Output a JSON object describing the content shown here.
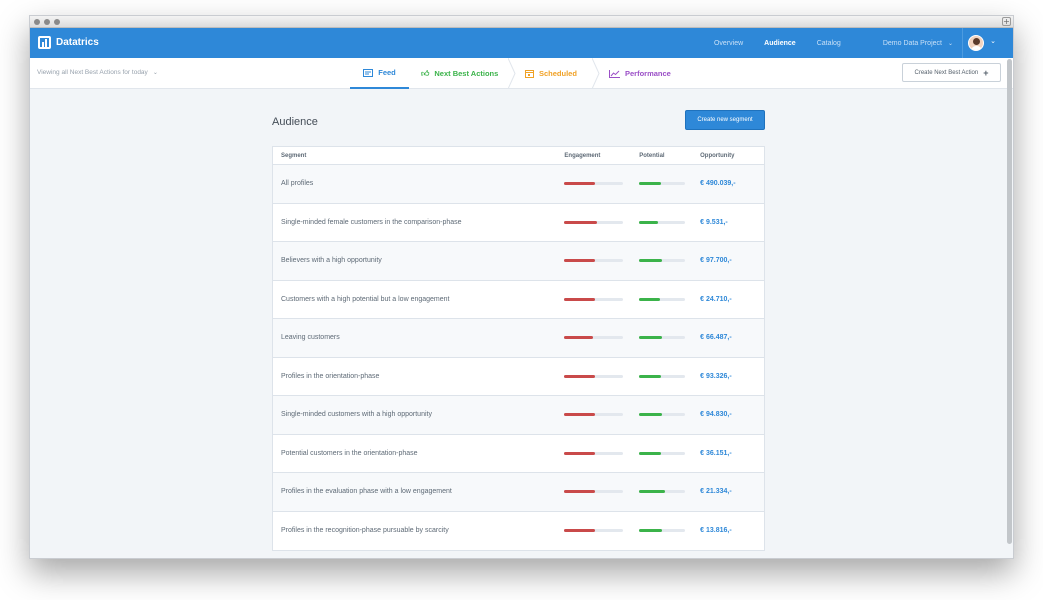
{
  "app": {
    "name": "Datatrics"
  },
  "topnav": {
    "items": [
      {
        "label": "Overview",
        "active": false
      },
      {
        "label": "Audience",
        "active": true
      },
      {
        "label": "Catalog",
        "active": false
      },
      {
        "label": "Demo Data Project",
        "active": false
      }
    ]
  },
  "subbar": {
    "filter_label": "Viewing all Next Best Actions for today",
    "tabs": [
      {
        "label": "Feed",
        "icon": "newspaper-icon",
        "color": "#2e88d8"
      },
      {
        "label": "Next Best Actions",
        "icon": "thumbs-up-icon",
        "color": "#3bb34a"
      },
      {
        "label": "Scheduled",
        "icon": "calendar-icon",
        "color": "#f0a125"
      },
      {
        "label": "Performance",
        "icon": "line-chart-icon",
        "color": "#9b4fc7"
      }
    ],
    "create_action_label": "Create Next Best Action",
    "create_action_plus": "+"
  },
  "audience": {
    "title": "Audience",
    "create_segment_label": "Create new segment",
    "columns": {
      "segment": "Segment",
      "engagement": "Engagement",
      "potential": "Potential",
      "opportunity": "Opportunity"
    },
    "rows": [
      {
        "segment": "All profiles",
        "engagement": 0.52,
        "potential": 0.48,
        "opportunity": "€ 490.039,-"
      },
      {
        "segment": "Single-minded female customers in the comparison-phase",
        "engagement": 0.55,
        "potential": 0.4,
        "opportunity": "€ 9.531,-"
      },
      {
        "segment": "Believers with a high opportunity",
        "engagement": 0.52,
        "potential": 0.5,
        "opportunity": "€ 97.700,-"
      },
      {
        "segment": "Customers with a high potential but a low engagement",
        "engagement": 0.52,
        "potential": 0.46,
        "opportunity": "€ 24.710,-"
      },
      {
        "segment": "Leaving customers",
        "engagement": 0.48,
        "potential": 0.5,
        "opportunity": "€ 66.487,-"
      },
      {
        "segment": "Profiles in the orientation-phase",
        "engagement": 0.52,
        "potential": 0.48,
        "opportunity": "€ 93.326,-"
      },
      {
        "segment": "Single-minded customers with a high opportunity",
        "engagement": 0.52,
        "potential": 0.5,
        "opportunity": "€ 94.830,-"
      },
      {
        "segment": "Potential customers in the orientation-phase",
        "engagement": 0.52,
        "potential": 0.48,
        "opportunity": "€ 36.151,-"
      },
      {
        "segment": "Profiles in the evaluation phase with a low engagement",
        "engagement": 0.52,
        "potential": 0.55,
        "opportunity": "€ 21.334,-"
      },
      {
        "segment": "Profiles in the recognition-phase pursuable by scarcity",
        "engagement": 0.52,
        "potential": 0.5,
        "opportunity": "€ 13.816,-"
      }
    ]
  }
}
